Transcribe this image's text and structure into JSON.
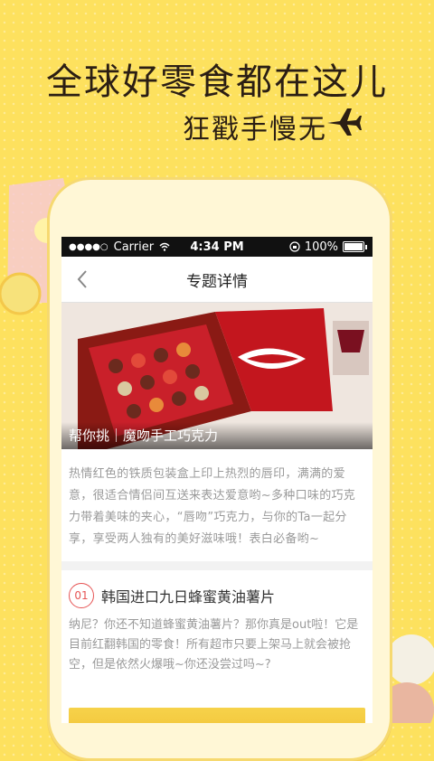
{
  "promo": {
    "headline": "全球好零食都在这儿",
    "subline": "狂戳手慢无"
  },
  "status_bar": {
    "carrier": "Carrier",
    "time": "4:34 PM",
    "battery": "100%"
  },
  "nav": {
    "title": "专题详情"
  },
  "hero": {
    "caption": "帮你挑｜魔吻手工巧克力"
  },
  "description": "热情红色的铁质包装盒上印上热烈的唇印，满满的爱意，很适合情侣间互送来表达爱意哟~多种口味的巧克力带着美味的夹心，“唇吻”巧克力，与你的Ta一起分享，享受两人独有的美好滋味哦！表白必备哟~",
  "item": {
    "number": "01",
    "title": "韩国进口九日蜂蜜黄油薯片",
    "text": "纳尼？你还不知道蜂蜜黄油薯片？那你真是out啦！它是目前红翻韩国的零食！所有超市只要上架马上就会被抢空，但是依然火爆哦~你还没尝过吗~?"
  },
  "colors": {
    "background": "#fde15e",
    "accent": "#e65454",
    "text_muted": "#9a9a9a"
  },
  "icons": [
    "airplane-icon",
    "wifi-icon",
    "lock-rotation-icon",
    "battery-icon",
    "back-chevron-icon"
  ]
}
